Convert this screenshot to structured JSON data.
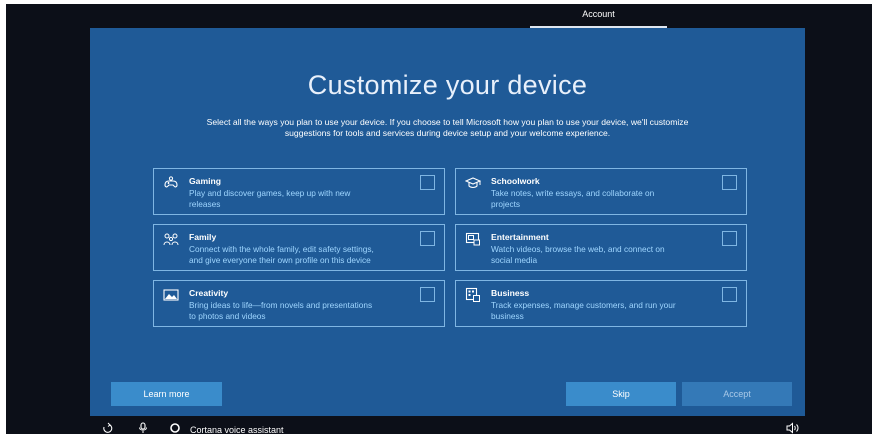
{
  "topbar": {
    "tab_label": "Account"
  },
  "main": {
    "title": "Customize your device",
    "subtitle_line1": "Select all the ways you plan to use your device. If you choose to tell Microsoft how you plan to use your device, we'll customize",
    "subtitle_line2": "suggestions for tools and services during device setup and your welcome experience."
  },
  "options": [
    {
      "title": "Gaming",
      "desc1": "Play and discover games, keep up with new",
      "desc2": "releases",
      "icon": "gaming-icon",
      "checked": false
    },
    {
      "title": "Schoolwork",
      "desc1": "Take notes, write essays, and collaborate on",
      "desc2": "projects",
      "icon": "graduation-cap-icon",
      "checked": false
    },
    {
      "title": "Family",
      "desc1": "Connect with the whole family, edit safety settings,",
      "desc2": "and give everyone their own profile on this device",
      "icon": "family-icon",
      "checked": false
    },
    {
      "title": "Entertainment",
      "desc1": "Watch videos, browse the web, and connect on",
      "desc2": "social media",
      "icon": "entertainment-icon",
      "checked": false
    },
    {
      "title": "Creativity",
      "desc1": "Bring ideas to life—from novels and presentations",
      "desc2": "to photos and videos",
      "icon": "image-icon",
      "checked": false
    },
    {
      "title": "Business",
      "desc1": "Track expenses, manage customers, and run your",
      "desc2": "business",
      "icon": "business-icon",
      "checked": false
    }
  ],
  "footer": {
    "learn_more_label": "Learn more",
    "skip_label": "Skip",
    "accept_label": "Accept"
  },
  "taskbar": {
    "cortana_label": "Cortana voice assistant"
  },
  "colors": {
    "panel": "#1f5a97",
    "accent_button": "#3a8ccb",
    "card_border": "#7fb6e3",
    "desc_text": "#9fd6ff"
  }
}
